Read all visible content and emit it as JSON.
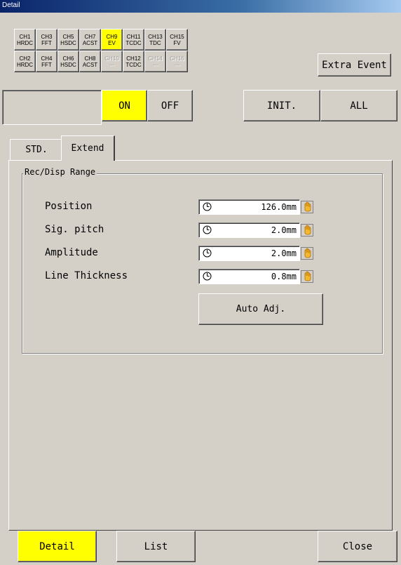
{
  "window": {
    "title": "Detail"
  },
  "channels": {
    "top": [
      {
        "name": "CH1",
        "type": "HRDC",
        "state": "focus"
      },
      {
        "name": "CH3",
        "type": "FFT",
        "state": "normal"
      },
      {
        "name": "CH5",
        "type": "HSDC",
        "state": "normal"
      },
      {
        "name": "CH7",
        "type": "ACST",
        "state": "normal"
      },
      {
        "name": "CH9",
        "type": "EV",
        "state": "selected"
      },
      {
        "name": "CH11",
        "type": "TCDC",
        "state": "normal"
      },
      {
        "name": "CH13",
        "type": "TDC",
        "state": "normal"
      },
      {
        "name": "CH15",
        "type": "FV",
        "state": "normal"
      }
    ],
    "bottom": [
      {
        "name": "CH2",
        "type": "HRDC",
        "state": "normal"
      },
      {
        "name": "CH4",
        "type": "FFT",
        "state": "normal"
      },
      {
        "name": "CH6",
        "type": "HSDC",
        "state": "normal"
      },
      {
        "name": "CH8",
        "type": "ACST",
        "state": "normal"
      },
      {
        "name": "CH10",
        "type": "---",
        "state": "disabled"
      },
      {
        "name": "CH12",
        "type": "TCDC",
        "state": "normal"
      },
      {
        "name": "CH14",
        "type": "---",
        "state": "disabled"
      },
      {
        "name": "CH16",
        "type": "---",
        "state": "disabled"
      }
    ]
  },
  "extra_event_label": "Extra Event",
  "toggle": {
    "on_label": "ON",
    "off_label": "OFF",
    "active": "ON"
  },
  "init_label": "INIT.",
  "all_label": "ALL",
  "tabs": [
    {
      "label": "STD.",
      "active": false
    },
    {
      "label": "Extend",
      "active": true
    }
  ],
  "group_title": "Rec/Disp Range",
  "rows": [
    {
      "label": "Position",
      "value": "126.0mm"
    },
    {
      "label": "Sig. pitch",
      "value": "2.0mm"
    },
    {
      "label": "Amplitude",
      "value": "2.0mm"
    },
    {
      "label": "Line Thickness",
      "value": "0.8mm"
    }
  ],
  "auto_adj_label": "Auto Adj.",
  "footer": {
    "detail_label": "Detail",
    "list_label": "List",
    "close_label": "Close",
    "active": "Detail"
  },
  "colors": {
    "highlight": "#ffff00",
    "face": "#d4d0c8",
    "title_bar": "#0a246a",
    "hand_icon": "#e8a000"
  },
  "icons": {
    "knob": "dial-icon",
    "picker": "hand-pointer-icon"
  }
}
